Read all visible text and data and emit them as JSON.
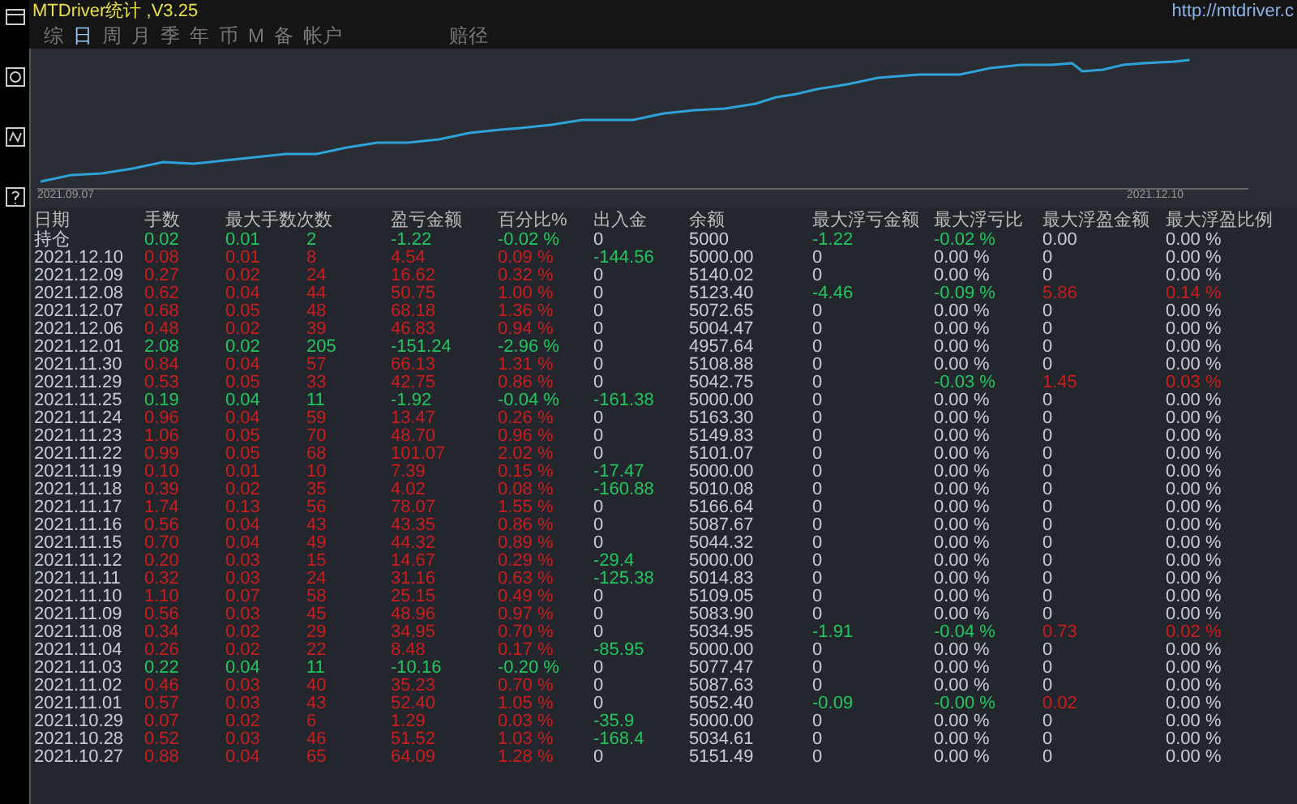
{
  "title": "MTDriver统计 ,V3.25",
  "url": "http://mtdriver.c",
  "toolbar": [
    {
      "kind": "window"
    },
    {
      "kind": "image"
    },
    {
      "kind": "wave"
    },
    {
      "kind": "help"
    }
  ],
  "tabs": [
    {
      "label": "综",
      "selected": false
    },
    {
      "label": "日",
      "selected": true
    },
    {
      "label": "周",
      "selected": false
    },
    {
      "label": "月",
      "selected": false
    },
    {
      "label": "季",
      "selected": false
    },
    {
      "label": "年",
      "selected": false
    },
    {
      "label": "币",
      "selected": false
    },
    {
      "label": "M",
      "selected": false
    },
    {
      "label": "备",
      "selected": false
    },
    {
      "label": "帐户",
      "selected": false
    },
    {
      "label": "赔径",
      "selected": false
    }
  ],
  "chart": {
    "start_label": "2021.09.07",
    "end_label": "2021.12.10"
  },
  "table": {
    "columns": [
      "日期",
      "手数",
      "最大手数次数",
      "盈亏金额",
      "百分比%",
      "出入金",
      "余额",
      "最大浮亏金额",
      "最大浮亏比",
      "最大浮盈金额",
      "最大浮盈比例"
    ],
    "rows": [
      {
        "date": "持仓",
        "color": "#22c55e",
        "values": [
          "0.02",
          "0.01",
          "2",
          "-1.22",
          "-0.02 %",
          "0",
          "5000",
          {
            "text": "-1.22",
            "color": "#22c55e"
          },
          {
            "text": "-0.02 %",
            "color": "#22c55e"
          },
          "0.00",
          "0.00 %"
        ]
      },
      {
        "date": "2021.12.10",
        "color": "#c81e1e",
        "values": [
          "0.08",
          "0.01",
          "8",
          "4.54",
          "0.09 %",
          {
            "text": "-144.56",
            "color": "#22c55e"
          },
          "5000.00",
          "0",
          "0.00 %",
          "0",
          "0.00 %"
        ]
      },
      {
        "date": "2021.12.09",
        "color": "#c81e1e",
        "values": [
          "0.27",
          "0.02",
          "24",
          "16.62",
          "0.32 %",
          "0",
          "5140.02",
          "0",
          "0.00 %",
          "0",
          "0.00 %"
        ]
      },
      {
        "date": "2021.12.08",
        "color": "#c81e1e",
        "values": [
          "0.62",
          "0.04",
          "44",
          "50.75",
          "1.00 %",
          "0",
          "5123.40",
          {
            "text": "-4.46",
            "color": "#22c55e"
          },
          {
            "text": "-0.09 %",
            "color": "#22c55e"
          },
          {
            "text": "5.86",
            "color": "#c81e1e"
          },
          {
            "text": "0.14 %",
            "color": "#c81e1e"
          }
        ]
      },
      {
        "date": "2021.12.07",
        "color": "#c81e1e",
        "values": [
          "0.68",
          "0.05",
          "48",
          "68.18",
          "1.36 %",
          "0",
          "5072.65",
          "0",
          "0.00 %",
          "0",
          "0.00 %"
        ]
      },
      {
        "date": "2021.12.06",
        "color": "#c81e1e",
        "values": [
          "0.48",
          "0.02",
          "39",
          "46.83",
          "0.94 %",
          "0",
          "5004.47",
          "0",
          "0.00 %",
          "0",
          "0.00 %"
        ]
      },
      {
        "date": "2021.12.01",
        "color": "#22c55e",
        "values": [
          "2.08",
          "0.02",
          "205",
          "-151.24",
          "-2.96 %",
          "0",
          "4957.64",
          "0",
          "0.00 %",
          "0",
          "0.00 %"
        ]
      },
      {
        "date": "2021.11.30",
        "color": "#c81e1e",
        "values": [
          "0.84",
          "0.04",
          "57",
          "66.13",
          "1.31 %",
          "0",
          "5108.88",
          "0",
          "0.00 %",
          "0",
          "0.00 %"
        ]
      },
      {
        "date": "2021.11.29",
        "color": "#c81e1e",
        "values": [
          "0.53",
          "0.05",
          "33",
          "42.75",
          "0.86 %",
          "0",
          "5042.75",
          "0",
          {
            "text": "-0.03 %",
            "color": "#22c55e"
          },
          {
            "text": "1.45",
            "color": "#c81e1e"
          },
          {
            "text": "0.03 %",
            "color": "#c81e1e"
          }
        ]
      },
      {
        "date": "2021.11.25",
        "color": "#22c55e",
        "values": [
          "0.19",
          "0.04",
          "11",
          "-1.92",
          "-0.04 %",
          {
            "text": "-161.38",
            "color": "#22c55e"
          },
          "5000.00",
          "0",
          "0.00 %",
          "0",
          "0.00 %"
        ]
      },
      {
        "date": "2021.11.24",
        "color": "#c81e1e",
        "values": [
          "0.96",
          "0.04",
          "59",
          "13.47",
          "0.26 %",
          "0",
          "5163.30",
          "0",
          "0.00 %",
          "0",
          "0.00 %"
        ]
      },
      {
        "date": "2021.11.23",
        "color": "#c81e1e",
        "values": [
          "1.06",
          "0.05",
          "70",
          "48.70",
          "0.96 %",
          "0",
          "5149.83",
          "0",
          "0.00 %",
          "0",
          "0.00 %"
        ]
      },
      {
        "date": "2021.11.22",
        "color": "#c81e1e",
        "values": [
          "0.99",
          "0.05",
          "68",
          "101.07",
          "2.02 %",
          "0",
          "5101.07",
          "0",
          "0.00 %",
          "0",
          "0.00 %"
        ]
      },
      {
        "date": "2021.11.19",
        "color": "#c81e1e",
        "values": [
          "0.10",
          "0.01",
          "10",
          "7.39",
          "0.15 %",
          {
            "text": "-17.47",
            "color": "#22c55e"
          },
          "5000.00",
          "0",
          "0.00 %",
          "0",
          "0.00 %"
        ]
      },
      {
        "date": "2021.11.18",
        "color": "#c81e1e",
        "values": [
          "0.39",
          "0.02",
          "35",
          "4.02",
          "0.08 %",
          {
            "text": "-160.88",
            "color": "#22c55e"
          },
          "5010.08",
          "0",
          "0.00 %",
          "0",
          "0.00 %"
        ]
      },
      {
        "date": "2021.11.17",
        "color": "#c81e1e",
        "values": [
          "1.74",
          "0.13",
          "56",
          "78.07",
          "1.55 %",
          "0",
          "5166.64",
          "0",
          "0.00 %",
          "0",
          "0.00 %"
        ]
      },
      {
        "date": "2021.11.16",
        "color": "#c81e1e",
        "values": [
          "0.56",
          "0.04",
          "43",
          "43.35",
          "0.86 %",
          "0",
          "5087.67",
          "0",
          "0.00 %",
          "0",
          "0.00 %"
        ]
      },
      {
        "date": "2021.11.15",
        "color": "#c81e1e",
        "values": [
          "0.70",
          "0.04",
          "49",
          "44.32",
          "0.89 %",
          "0",
          "5044.32",
          "0",
          "0.00 %",
          "0",
          "0.00 %"
        ]
      },
      {
        "date": "2021.11.12",
        "color": "#c81e1e",
        "values": [
          "0.20",
          "0.03",
          "15",
          "14.67",
          "0.29 %",
          {
            "text": "-29.4",
            "color": "#22c55e"
          },
          "5000.00",
          "0",
          "0.00 %",
          "0",
          "0.00 %"
        ]
      },
      {
        "date": "2021.11.11",
        "color": "#c81e1e",
        "values": [
          "0.32",
          "0.03",
          "24",
          "31.16",
          "0.63 %",
          {
            "text": "-125.38",
            "color": "#22c55e"
          },
          "5014.83",
          "0",
          "0.00 %",
          "0",
          "0.00 %"
        ]
      },
      {
        "date": "2021.11.10",
        "color": "#c81e1e",
        "values": [
          "1.10",
          "0.07",
          "58",
          "25.15",
          "0.49 %",
          "0",
          "5109.05",
          "0",
          "0.00 %",
          "0",
          "0.00 %"
        ]
      },
      {
        "date": "2021.11.09",
        "color": "#c81e1e",
        "values": [
          "0.56",
          "0.03",
          "45",
          "48.96",
          "0.97 %",
          "0",
          "5083.90",
          "0",
          "0.00 %",
          "0",
          "0.00 %"
        ]
      },
      {
        "date": "2021.11.08",
        "color": "#c81e1e",
        "values": [
          "0.34",
          "0.02",
          "29",
          "34.95",
          "0.70 %",
          "0",
          "5034.95",
          {
            "text": "-1.91",
            "color": "#22c55e"
          },
          {
            "text": "-0.04 %",
            "color": "#22c55e"
          },
          {
            "text": "0.73",
            "color": "#c81e1e"
          },
          {
            "text": "0.02 %",
            "color": "#c81e1e"
          }
        ]
      },
      {
        "date": "2021.11.04",
        "color": "#c81e1e",
        "values": [
          "0.26",
          "0.02",
          "22",
          "8.48",
          "0.17 %",
          {
            "text": "-85.95",
            "color": "#22c55e"
          },
          "5000.00",
          "0",
          "0.00 %",
          "0",
          "0.00 %"
        ]
      },
      {
        "date": "2021.11.03",
        "color": "#22c55e",
        "values": [
          "0.22",
          "0.04",
          "11",
          "-10.16",
          "-0.20 %",
          "0",
          "5077.47",
          "0",
          "0.00 %",
          "0",
          "0.00 %"
        ]
      },
      {
        "date": "2021.11.02",
        "color": "#c81e1e",
        "values": [
          "0.46",
          "0.03",
          "40",
          "35.23",
          "0.70 %",
          "0",
          "5087.63",
          "0",
          "0.00 %",
          "0",
          "0.00 %"
        ]
      },
      {
        "date": "2021.11.01",
        "color": "#c81e1e",
        "values": [
          "0.57",
          "0.03",
          "43",
          "52.40",
          "1.05 %",
          "0",
          "5052.40",
          {
            "text": "-0.09",
            "color": "#22c55e"
          },
          {
            "text": "-0.00 %",
            "color": "#22c55e"
          },
          {
            "text": "0.02",
            "color": "#c81e1e"
          },
          "0.00 %"
        ]
      },
      {
        "date": "2021.10.29",
        "color": "#c81e1e",
        "values": [
          "0.07",
          "0.02",
          "6",
          "1.29",
          "0.03 %",
          {
            "text": "-35.9",
            "color": "#22c55e"
          },
          "5000.00",
          "0",
          "0.00 %",
          "0",
          "0.00 %"
        ]
      },
      {
        "date": "2021.10.28",
        "color": "#c81e1e",
        "values": [
          "0.52",
          "0.03",
          "46",
          "51.52",
          "1.03 %",
          {
            "text": "-168.4",
            "color": "#22c55e"
          },
          "5034.61",
          "0",
          "0.00 %",
          "0",
          "0.00 %"
        ]
      },
      {
        "date": "2021.10.27",
        "color": "#c81e1e",
        "values": [
          "0.88",
          "0.04",
          "65",
          "64.09",
          "1.28 %",
          "0",
          "5151.49",
          "0",
          "0.00 %",
          "0",
          "0.00 %"
        ]
      }
    ]
  }
}
